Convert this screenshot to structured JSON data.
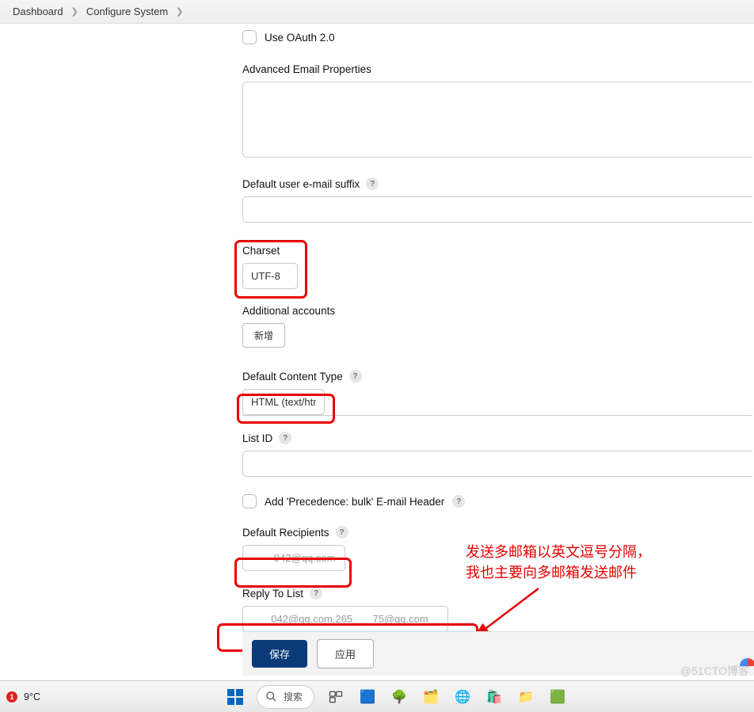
{
  "breadcrumb": {
    "item1": "Dashboard",
    "item2": "Configure System"
  },
  "oauth": {
    "label": "Use OAuth 2.0"
  },
  "advancedEmail": {
    "label": "Advanced Email Properties",
    "value": ""
  },
  "defaultSuffix": {
    "label": "Default user e-mail suffix",
    "value": ""
  },
  "charset": {
    "label": "Charset",
    "value": "UTF-8"
  },
  "additional": {
    "label": "Additional accounts",
    "addBtn": "新增"
  },
  "contentType": {
    "label": "Default Content Type",
    "value": "HTML (text/html)"
  },
  "listId": {
    "label": "List ID",
    "value": ""
  },
  "precedence": {
    "label": "Add 'Precedence: bulk' E-mail Header"
  },
  "defaultRecipients": {
    "label": "Default Recipients",
    "value": "        942@qq.com"
  },
  "replyTo": {
    "label": "Reply To List",
    "value": "       042@qq.com,265       75@qq.com"
  },
  "buttons": {
    "save": "保存",
    "apply": "应用"
  },
  "annotation": {
    "line1": "发送多邮箱以英文逗号分隔，",
    "line2": "我也主要向多邮箱发送邮件"
  },
  "taskbar": {
    "temperature": "9°C",
    "badge": "1",
    "searchPlaceholder": "搜索"
  },
  "watermark": "@51CTO博客"
}
